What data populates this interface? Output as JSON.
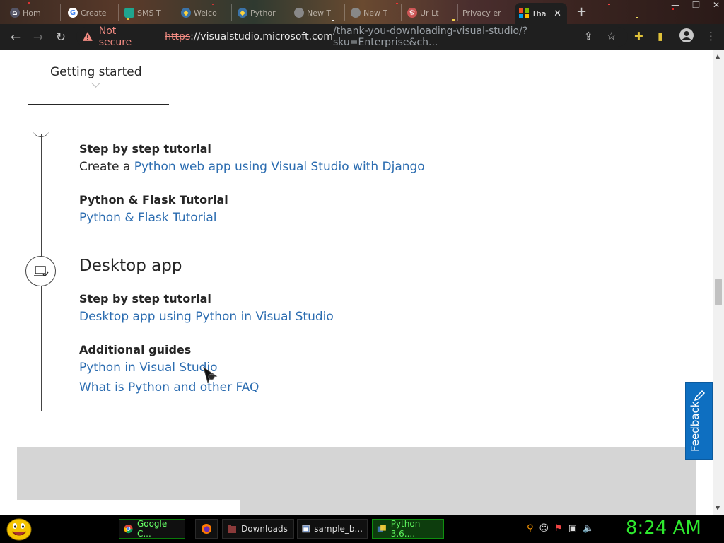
{
  "browser": {
    "tabs": [
      {
        "title": "Hom",
        "icon": "app-icon"
      },
      {
        "title": "Create",
        "icon": "google-icon"
      },
      {
        "title": "SMS T",
        "icon": "sms-icon"
      },
      {
        "title": "Welco",
        "icon": "python-icon"
      },
      {
        "title": "Pythor",
        "icon": "python-icon"
      },
      {
        "title": "New T",
        "icon": "chrome-icon"
      },
      {
        "title": "New T",
        "icon": "chrome-icon"
      },
      {
        "title": "Ur Lt",
        "icon": "gear-icon"
      },
      {
        "title": "Privacy er",
        "icon": "blank-icon"
      },
      {
        "title": "Tha",
        "icon": "microsoft-icon",
        "active": true
      }
    ],
    "security_label": "Not secure",
    "url_scheme": "https",
    "url_host": "://visualstudio.microsoft.com",
    "url_path": "/thank-you-downloading-visual-studio/?sku=Enterprise&ch..."
  },
  "page": {
    "getting_started": "Getting started",
    "django": {
      "heading": "Step by step tutorial",
      "prefix": "Create a ",
      "link": "Python web app using Visual Studio with Django"
    },
    "flask": {
      "heading": "Python & Flask Tutorial",
      "link": "Python & Flask Tutorial"
    },
    "desktop": {
      "title": "Desktop app",
      "tutorial_heading": "Step by step tutorial",
      "tutorial_link": "Desktop app using Python in Visual Studio",
      "guides_heading": "Additional guides",
      "guide_links": [
        "Python in Visual Studio",
        "What is Python and other FAQ"
      ]
    },
    "feedback": "Feedback"
  },
  "taskbar": {
    "tasks": [
      {
        "label": "Google C...",
        "icon": "chrome-icon"
      },
      {
        "label": "",
        "icon": "firefox-icon"
      },
      {
        "label": "Downloads",
        "icon": "folder-icon"
      },
      {
        "label": "sample_b...",
        "icon": "window-icon"
      },
      {
        "label": "Python 3.6....",
        "icon": "python-installer-icon"
      }
    ],
    "clock": "8:24 AM"
  },
  "colors": {
    "link": "#2b6cb0",
    "feedback_bg": "#0e6fc1",
    "clock": "#2ee82e",
    "warning": "#f28b82"
  }
}
